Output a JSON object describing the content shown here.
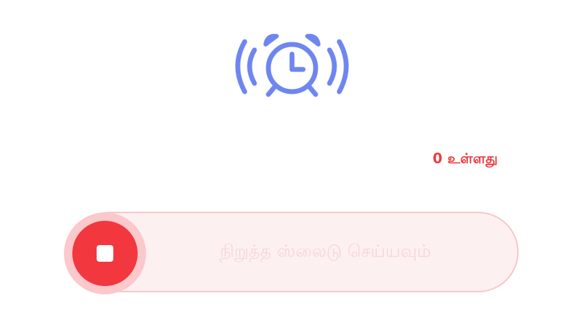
{
  "alarm": {
    "icon": "ringing-alarm-clock-icon",
    "color": "#6f86ef"
  },
  "status": {
    "count_text": "0 உள்ளது",
    "color": "#ef3b3f"
  },
  "slider": {
    "label": "நிறுத்த ஸ்லைடு செய்யவும்",
    "handle_icon": "stop-icon",
    "accent": "#f2373f"
  }
}
